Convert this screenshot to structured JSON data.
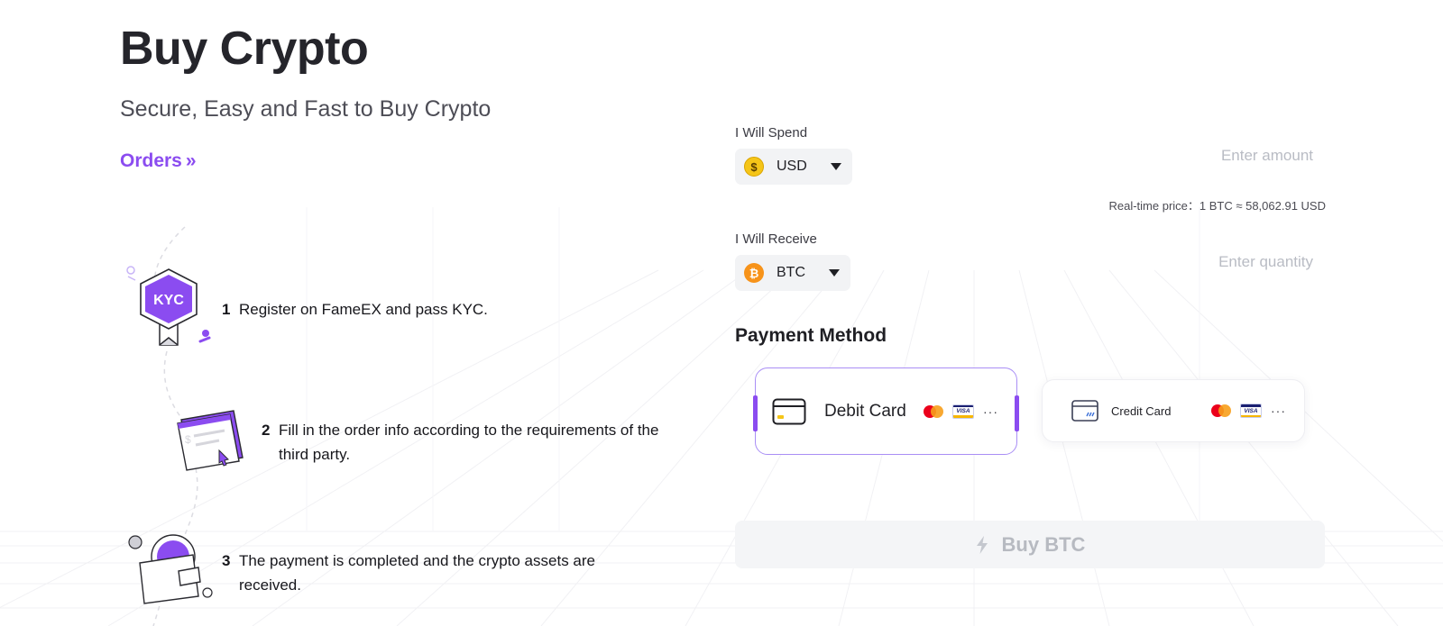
{
  "page": {
    "title": "Buy Crypto",
    "subtitle": "Secure, Easy and Fast to Buy Crypto",
    "orders_link": "Orders",
    "orders_chevron": "»"
  },
  "steps": [
    {
      "number": "1",
      "text": "Register on FameEX and pass KYC.",
      "icon": "kyc-badge-icon",
      "badge_text": "KYC"
    },
    {
      "number": "2",
      "text": "Fill in the order info according to the requirements of the third party.",
      "icon": "order-card-icon"
    },
    {
      "number": "3",
      "text": "The payment is completed and the crypto assets are received.",
      "icon": "wallet-coin-icon"
    }
  ],
  "form": {
    "spend": {
      "label": "I Will Spend",
      "currency": "USD",
      "coin_glyph": "$",
      "placeholder": "Enter amount"
    },
    "price": {
      "text": "Real-time price：1 BTC ≈ 58,062.91 USD"
    },
    "receive": {
      "label": "I Will Receive",
      "currency": "BTC",
      "coin_glyph": "₿",
      "placeholder": "Enter quantity"
    },
    "payment_method": {
      "heading": "Payment Method",
      "options": [
        {
          "name": "Debit Card",
          "selected": true,
          "brands": [
            "mastercard-icon",
            "visa-icon"
          ],
          "more": "···"
        },
        {
          "name": "Credit Card",
          "selected": false,
          "brands": [
            "mastercard-icon",
            "visa-icon"
          ],
          "more": "···"
        }
      ]
    },
    "buy_button": {
      "label": "Buy BTC",
      "icon": "lightning-icon",
      "enabled": false
    }
  },
  "colors": {
    "accent": "#8b4cf0",
    "title": "#25252b",
    "disabled_bg": "#f4f5f7",
    "disabled_text": "#b7bac1",
    "usd_coin": "#f5c518",
    "btc_coin": "#f7931a"
  }
}
